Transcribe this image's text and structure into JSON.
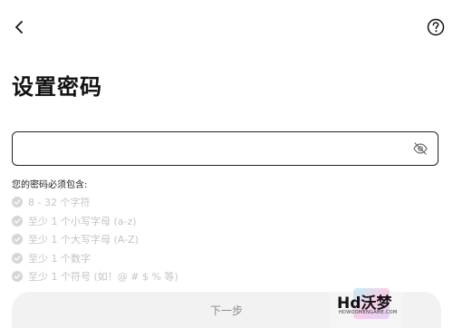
{
  "header": {
    "back_icon": "chevron-left-icon",
    "help_icon": "question-circle-icon"
  },
  "page": {
    "title": "设置密码"
  },
  "password_field": {
    "value": "",
    "placeholder": "",
    "toggle_icon": "eye-off-icon"
  },
  "requirements": {
    "heading": "您的密码必须包含:",
    "items": [
      "8 - 32 个字符",
      "至少 1 个小写字母 (a-z)",
      "至少 1 个大写字母 (A-Z)",
      "至少 1 个数字",
      "至少 1 个符号 (如！@ # $ % 等)"
    ],
    "inactive_color": "#c4c4c4"
  },
  "actions": {
    "next_label": "下一步"
  },
  "watermark": {
    "text": "Hd沃梦",
    "sub": "HDWOOMENGAME.COM"
  }
}
